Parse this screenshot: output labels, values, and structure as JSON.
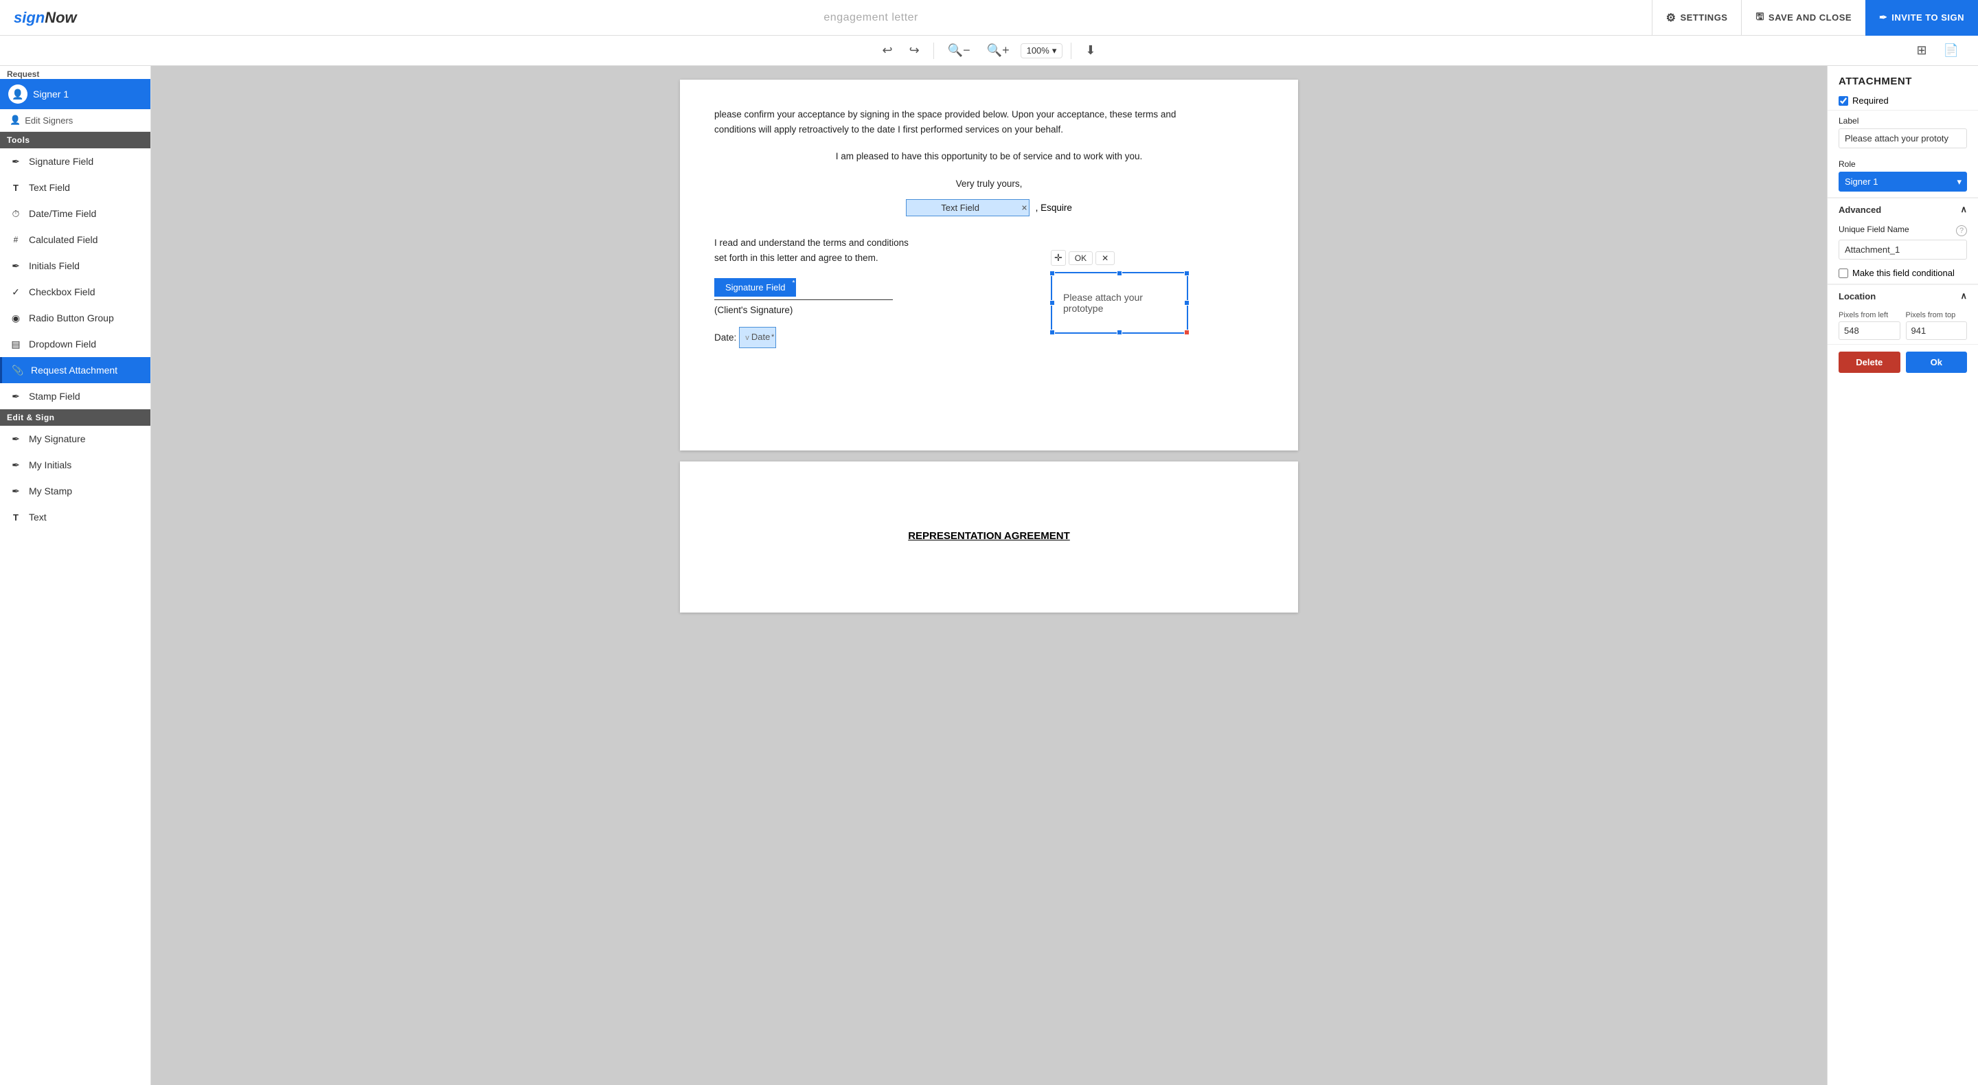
{
  "header": {
    "logo_blue": "sign",
    "logo_dark": "Now",
    "doc_title": "engagement letter",
    "settings_label": "SETTINGS",
    "save_label": "SAVE AND CLOSE",
    "invite_label": "INVITE TO SIGN"
  },
  "toolbar": {
    "zoom_value": "100%",
    "zoom_placeholder": "100%"
  },
  "sidebar": {
    "request_label": "Request",
    "signer_name": "Signer 1",
    "edit_signers_label": "Edit Signers",
    "tools_label": "Tools",
    "tools": [
      {
        "id": "signature",
        "label": "Signature Field",
        "icon": "✒"
      },
      {
        "id": "text",
        "label": "Text Field",
        "icon": "T"
      },
      {
        "id": "datetime",
        "label": "Date/Time Field",
        "icon": "⏱"
      },
      {
        "id": "calculated",
        "label": "Calculated Field",
        "icon": "#"
      },
      {
        "id": "initials",
        "label": "Initials Field",
        "icon": "✒"
      },
      {
        "id": "checkbox",
        "label": "Checkbox Field",
        "icon": "✓"
      },
      {
        "id": "radio",
        "label": "Radio Button Group",
        "icon": "◉"
      },
      {
        "id": "dropdown",
        "label": "Dropdown Field",
        "icon": "▤"
      },
      {
        "id": "attachment",
        "label": "Request Attachment",
        "icon": "📎"
      },
      {
        "id": "stamp",
        "label": "Stamp Field",
        "icon": "✒"
      }
    ],
    "edit_sign_label": "Edit & Sign",
    "edit_sign_tools": [
      {
        "id": "my-signature",
        "label": "My Signature",
        "icon": "✒"
      },
      {
        "id": "my-initials",
        "label": "My Initials",
        "icon": "✒"
      },
      {
        "id": "my-stamp",
        "label": "My Stamp",
        "icon": "✒"
      },
      {
        "id": "text-es",
        "label": "Text",
        "icon": "T"
      }
    ]
  },
  "canvas": {
    "page1": {
      "text1": "please confirm your acceptance by signing in the space provided below. Upon your acceptance, these terms and",
      "text2": "conditions will apply retroactively to the date I first performed services on your behalf.",
      "text3": "I am pleased to have this opportunity to be of service and to work with you.",
      "text4": "Very truly yours,",
      "text_field_label": "Text Field",
      "esquire_suffix": ", Esquire",
      "text5": "I read and understand the terms and conditions",
      "text6": "set forth in this letter and agree to them.",
      "signature_field_label": "Signature Field",
      "client_sig_label": "(Client's Signature)",
      "date_label": "Date:",
      "date_field_label": "Date",
      "attachment_label": "Please attach your prototype",
      "ok_btn": "OK"
    },
    "page2": {
      "title": "REPRESENTATION AGREEMENT"
    }
  },
  "right_panel": {
    "section_title": "ATTACHMENT",
    "required_label": "Required",
    "required_checked": true,
    "label_title": "Label",
    "label_value": "Please attach your prototy",
    "label_placeholder": "Please attach your prototype",
    "role_title": "Role",
    "role_value": "Signer 1",
    "role_options": [
      "Signer 1"
    ],
    "advanced_label": "Advanced",
    "unique_field_title": "Unique Field Name",
    "unique_field_value": "Attachment_1",
    "conditional_label": "Make this field conditional",
    "conditional_checked": false,
    "location_label": "Location",
    "pixels_left_label": "Pixels from left",
    "pixels_left_value": "548",
    "pixels_top_label": "Pixels from top",
    "pixels_top_value": "941",
    "delete_btn": "Delete",
    "ok_btn": "Ok"
  }
}
